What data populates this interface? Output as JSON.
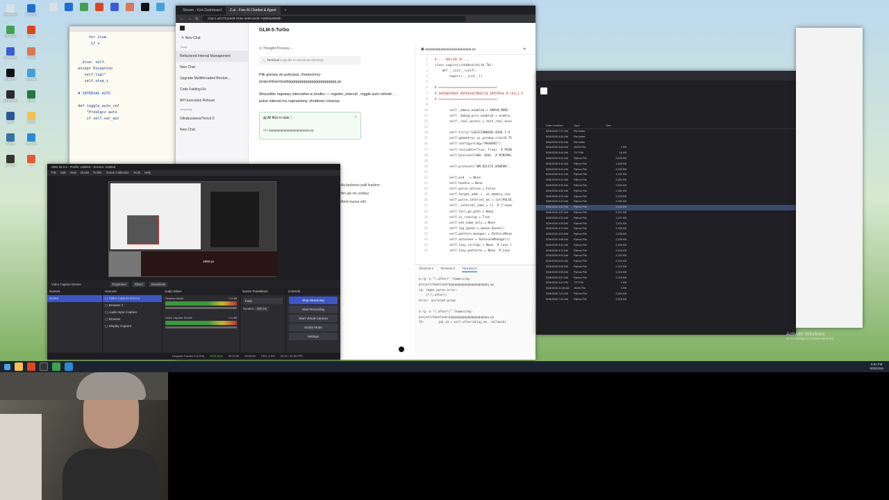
{
  "desktop": {
    "icons": [
      {
        "label": "Recycle Bin",
        "color": "#d8e0ea"
      },
      {
        "label": "ACI ONE",
        "color": "#1f6fd1"
      },
      {
        "label": "MS Cloud",
        "color": "#3fa34d"
      },
      {
        "label": "Brave",
        "color": "#e0451f"
      },
      {
        "label": "DeepSeek",
        "color": "#3a5ad8"
      },
      {
        "label": "Claude",
        "color": "#d97757"
      },
      {
        "label": "ChatGPT",
        "color": "#111111"
      },
      {
        "label": "Notepad",
        "color": "#46a0d8"
      },
      {
        "label": "OBS Studio",
        "color": "#2b2b2b"
      },
      {
        "label": "Excel",
        "color": "#1f7a43"
      },
      {
        "label": "Word",
        "color": "#2b579a"
      },
      {
        "label": "Folder",
        "color": "#f2c14e"
      },
      {
        "label": "Python",
        "color": "#3772a4"
      },
      {
        "label": "VS Code",
        "color": "#2a8ad8"
      },
      {
        "label": "Terminal",
        "color": "#333333"
      },
      {
        "label": "Git",
        "color": "#e45a33"
      }
    ],
    "activate_windows": {
      "title": "Activate Windows",
      "subtitle": "Go to Settings to activate Windows."
    }
  },
  "browser": {
    "tabs": [
      "Stream - Kick Dashboard",
      "Z.ai - Free AI Chatbot & Agent",
      "+"
    ],
    "url": "chat.z.ai/c/71118dd-316e-4eb6-8e36-748d3a2658f5",
    "chat_title": "GLM-5-Turbo",
    "sidebar": {
      "new_chat": "New Chat",
      "today": "Today",
      "items": [
        "Refactored Interval Management",
        "New Chat",
        "Upgrade Multithreaded Blocker...",
        "Code Folding Fix",
        "API Execution Refusal"
      ],
      "previous": "Yesterday",
      "older_items": [
        "Ultrabusiness/Yoov3.0",
        "New Chat"
      ]
    },
    "thought_process": "Thought Process",
    "terminal_chip": {
      "label": "Terminal",
      "desc": "Copy file to download directory"
    },
    "message_1": "Plik gotowy do pobrania: /home/z/my-project/download/qqqqqqqqqqqqqqqqqqqqqqq.py",
    "message_2": "Wszystkie naprawy intervalów w środku — register_interval , toggle auto refresh , pulse interval ms naprawiony, shutdown cleanup.",
    "files_card": {
      "title": "All files in task",
      "count": "1",
      "file": "qqqqqqqqqqqqqqqqqqqqqqq.py"
    },
    "partial_text": [
      "ollą będziesz palił kupilem",
      "chin jak nie zrobisz",
      "efterki kurwa mbi"
    ]
  },
  "code_panel": {
    "filename": "qqqqqqqqqqqqqqqqqqqqqqqqq.py",
    "lines": [
      {
        "n": "1",
        "code": "# ... ARCLEN-JA ..."
      },
      {
        "n": "2",
        "code": "class Logistc(ctkAbsolut(tk.Tk):"
      },
      {
        "n": "3",
        "code": "    def __init__(self):"
      },
      {
        "n": "4",
        "code": "        super().__init__()"
      },
      {
        "n": "5",
        "code": ""
      },
      {
        "n": "6",
        "code": "# ================================"
      },
      {
        "n": "7",
        "code": "# ZARZĄDZANIE WSPÓŁBIEŻNOŚCIĄ INTERVAŁ W CALLI A"
      },
      {
        "n": "8",
        "code": "# ================================"
      },
      {
        "n": "9",
        "code": ""
      },
      {
        "n": "10",
        "code": "        self._admin_enabled = ADMIN_MODE"
      },
      {
        "n": "11",
        "code": "        self._debug_priv_enabled = enable_"
      },
      {
        "n": "12",
        "code": "        self._real_access = test_real_acce"
      },
      {
        "n": "13",
        "code": ""
      },
      {
        "n": "14",
        "code": "        self.title(\"LOGISTANNING WIEK 5.9"
      },
      {
        "n": "15",
        "code": "        self.geometry(_ui_window_size(0.75"
      },
      {
        "n": "16",
        "code": "        self.configure(bg=\"#0d0905\")"
      },
      {
        "n": "17",
        "code": "        self.resizable(True, True)  # POZW"
      },
      {
        "n": "18",
        "code": "        self.minsize(1300, 850)  # MINIMAL"
      },
      {
        "n": "19",
        "code": ""
      },
      {
        "n": "20",
        "code": "        self.protocol(\"WM_DELETE_WINDOW\","
      },
      {
        "n": "21",
        "code": ""
      },
      {
        "n": "22",
        "code": "        self.pid   = None"
      },
      {
        "n": "23",
        "code": "        self.handle = None"
      },
      {
        "n": "24",
        "code": "        self.pulse_active = False"
      },
      {
        "n": "25",
        "code": "        self.target_addr = _ai_memory_coo"
      },
      {
        "n": "26",
        "code": "        self.pulse_interval_ms = int(PULSE_"
      },
      {
        "n": "27",
        "code": "        self._interval_jobs = {}  # {\"nazw"
      },
      {
        "n": "28",
        "code": "        self.full_pe_path = None"
      },
      {
        "n": "29",
        "code": "        self.is_running = True"
      },
      {
        "n": "30",
        "code": "        self.exe_name_only = None"
      },
      {
        "n": "31",
        "code": "        self.log_queue = queue.Queue()"
      },
      {
        "n": "32",
        "code": "        self.pattern_manager = PatternMana"
      },
      {
        "n": "33",
        "code": "        self.autosave = AutosaveManager()"
      },
      {
        "n": "34",
        "code": "        self.lazy_strings = None  # Lazy l"
      },
      {
        "n": "35",
        "code": "        self.lazy_patterns = None  # Lazy"
      }
    ]
  },
  "terminals": {
    "tabs": [
      "Terminal 1",
      "Terminal 2",
      "Terminal 3"
    ],
    "lines": [
      "$ rg -n \"\\.after(\" /home/z/my-project/download/qqqqqqqqqqqqqqqqqqqqqqq.py",
      "rg: regex parse error:",
      "    (?:\\.after()",
      "error: unclosed group",
      "",
      "$ rg -n \"\\.after\\(\" /home/z/my-project/download/qqqqqqqqqqqqqqqqqqqqqqq.py",
      "76:        job_id = self.after(delay_ms, callback)"
    ]
  },
  "obs": {
    "title": "OBS 32.0.4 - Profile: Untitled - Scenes: Untitled",
    "menu": [
      "File",
      "Edit",
      "View",
      "Docks",
      "Profile",
      "Scene Collection",
      "Tools",
      "Help"
    ],
    "preview_label": "1958 px",
    "source_name": "Video Capture Device",
    "toolbar_buttons": [
      "Properties",
      "Filters",
      "Deactivate"
    ],
    "docks": {
      "scenes": {
        "title": "Scenes",
        "items": [
          "Scene"
        ]
      },
      "sources": {
        "title": "Sources",
        "items": [
          "Video Capture Device",
          "Browser 2",
          "Audio Input Capture",
          "Browser",
          "Display Capture"
        ]
      },
      "mixer": {
        "title": "Audio Mixer",
        "channels": [
          {
            "name": "Desktop Audio",
            "db": "0.0 dB"
          },
          {
            "name": "Video Capture Device",
            "db": "0.0 dB"
          }
        ]
      },
      "transitions": {
        "title": "Scene Transitions",
        "type": "Fade",
        "duration_label": "Duration",
        "duration": "300 ms"
      },
      "controls": {
        "title": "Controls",
        "buttons": [
          "Stop Streaming",
          "Start Recording",
          "Start Virtual Camera",
          "Studio Mode",
          "Settings"
        ]
      }
    },
    "status": {
      "dropped": "Dropped Frames 0 (0.0%)",
      "kbps": "8233 kbps",
      "time": "00:29:50",
      "rec": "00:00:00",
      "cpu": "CPU: 0.3%",
      "fps": "30.00 / 30.00 FPS"
    }
  },
  "explorer": {
    "columns": [
      "Date modified",
      "Type",
      "Size"
    ],
    "rows": [
      {
        "date": "5/28/2026 7:37 AM",
        "type": "File folder",
        "size": ""
      },
      {
        "date": "5/28/2026 5:34 AM",
        "type": "File folder",
        "size": ""
      },
      {
        "date": "5/28/2026 5:26 AM",
        "type": "File folder",
        "size": ""
      },
      {
        "date": "5/28/2026 5:46 AM",
        "type": "JSON File",
        "size": "1 KB"
      },
      {
        "date": "5/28/2026 5:45 AM",
        "type": "TXT File",
        "size": "16 KB"
      },
      {
        "date": "5/28/2026 5:41 AM",
        "type": "Python File",
        "size": "2,626 KB"
      },
      {
        "date": "5/28/2026 5:41 AM",
        "type": "Python File",
        "size": "1,949 KB"
      },
      {
        "date": "5/28/2026 5:41 AM",
        "type": "Python File",
        "size": "2,233 KB"
      },
      {
        "date": "5/28/2026 5:41 AM",
        "type": "Python File",
        "size": "1,192 KB"
      },
      {
        "date": "5/28/2026 5:41 AM",
        "type": "Python File",
        "size": "2,254 KB"
      },
      {
        "date": "5/28/2026 5:39 AM",
        "type": "Python File",
        "size": "2,254 KB"
      },
      {
        "date": "5/28/2026 4:52 AM",
        "type": "Python File",
        "size": "2,281 KB"
      },
      {
        "date": "5/28/2026 4:22 AM",
        "type": "Python File",
        "size": "2,233 KB"
      },
      {
        "date": "5/28/2026 3:47 AM",
        "type": "Python File",
        "size": "2,252 KB"
      },
      {
        "date": "5/28/2026 3:00 PM",
        "type": "Python File",
        "size": "2,233 KB"
      },
      {
        "date": "5/28/2026 4:57 AM",
        "type": "Python File",
        "size": "2,227 KB"
      },
      {
        "date": "5/28/2026 4:31 AM",
        "type": "Python File",
        "size": "1,237 KB"
      },
      {
        "date": "5/28/2026 4:29 AM",
        "type": "Python File",
        "size": "2,211 KB"
      },
      {
        "date": "5/28/2026 4:17 AM",
        "type": "Python File",
        "size": "2,228 KB"
      },
      {
        "date": "5/28/2026 4:03 AM",
        "type": "Python File",
        "size": "2,228 KB"
      },
      {
        "date": "5/28/2026 3:58 AM",
        "type": "Python File",
        "size": "2,226 KB"
      },
      {
        "date": "5/28/2026 3:31 AM",
        "type": "Python File",
        "size": "2,226 KB"
      },
      {
        "date": "5/28/2026 3:12 AM",
        "type": "Python File",
        "size": "2,225 KB"
      },
      {
        "date": "5/28/2026 6:03 AM",
        "type": "Python File",
        "size": "2,220 KB"
      },
      {
        "date": "5/28/2026 6:01 AM",
        "type": "Python File",
        "size": "2,222 KB"
      },
      {
        "date": "5/28/2026 6:00 AM",
        "type": "Python File",
        "size": "2,222 KB"
      },
      {
        "date": "5/28/2026 5:59 AM",
        "type": "Python File",
        "size": "2,219 KB"
      },
      {
        "date": "5/28/2026 5:57 AM",
        "type": "Python File",
        "size": "2,218 KB"
      },
      {
        "date": "5/28/2026 4:41 PM",
        "type": "TXT File",
        "size": "1 KB"
      },
      {
        "date": "5/28/2026 11:26 AM",
        "type": "JSON File",
        "size": "1 KB"
      },
      {
        "date": "5/28/2026 7:41 AM",
        "type": "Python File",
        "size": "2,424 KB"
      },
      {
        "date": "5/28/2026 7:41 AM",
        "type": "Python File",
        "size": "2,218 KB"
      }
    ]
  },
  "tray": {
    "time": "5:51 PM",
    "date": "5/28/2026"
  }
}
